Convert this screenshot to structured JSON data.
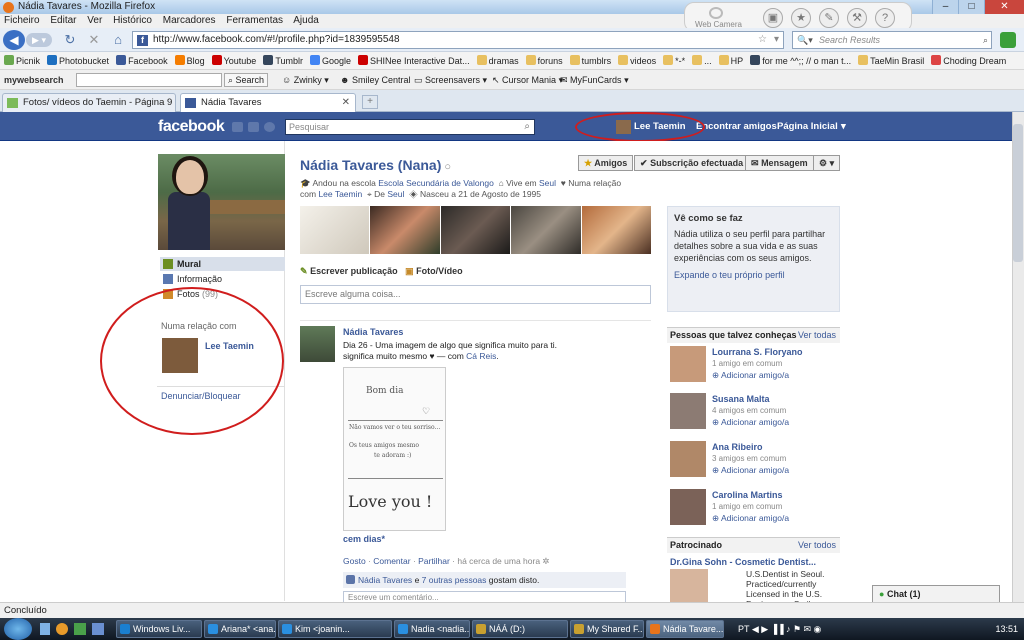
{
  "window": {
    "title": "Nádia Tavares - Mozilla Firefox"
  },
  "menu": [
    "Ficheiro",
    "Editar",
    "Ver",
    "Histórico",
    "Marcadores",
    "Ferramentas",
    "Ajuda"
  ],
  "webcam": {
    "label": "Web Camera"
  },
  "nav": {
    "url": "http://www.facebook.com/#!/profile.php?id=1839595548",
    "search_placeholder": "Search Results"
  },
  "bookmarks": [
    {
      "label": "Picnik",
      "color": "#6aa84f"
    },
    {
      "label": "Photobucket",
      "color": "#1d6fc0"
    },
    {
      "label": "Facebook",
      "color": "#3b5998"
    },
    {
      "label": "Blog",
      "color": "#f57d00"
    },
    {
      "label": "Youtube",
      "color": "#cc0000"
    },
    {
      "label": "Tumblr",
      "color": "#35465c"
    },
    {
      "label": "Google",
      "color": "#4285f4"
    },
    {
      "label": "SHINee Interactive Dat...",
      "color": "#cc0000"
    },
    {
      "label": "dramas",
      "color": "#e8c060"
    },
    {
      "label": "foruns",
      "color": "#e8c060"
    },
    {
      "label": "tumblrs",
      "color": "#e8c060"
    },
    {
      "label": "videos",
      "color": "#e8c060"
    },
    {
      "label": "*-*",
      "color": "#e8c060"
    },
    {
      "label": "...",
      "color": "#e8c060"
    },
    {
      "label": "HP",
      "color": "#e8c060"
    },
    {
      "label": "for me ^^;; // o man t...",
      "color": "#35465c"
    },
    {
      "label": "TaeMin Brasil",
      "color": "#e8c060"
    },
    {
      "label": "Choding Dream",
      "color": "#d44"
    }
  ],
  "toolbar2": {
    "brand": "mywebsearch",
    "search_btn": "Search",
    "items": [
      "Zwinky",
      "Smiley Central",
      "Screensavers",
      "Cursor Mania",
      "MyFunCards"
    ]
  },
  "tabs": [
    {
      "label": "Fotos/ vídeos do Taemin - Página 9"
    },
    {
      "label": "Nádia Tavares"
    }
  ],
  "fb": {
    "logo": "facebook",
    "search_placeholder": "Pesquisar",
    "user": "Lee Taemin",
    "nav": [
      "Encontrar amigos",
      "Página Inicial"
    ],
    "left": {
      "nav": [
        {
          "label": "Mural"
        },
        {
          "label": "Informação"
        },
        {
          "label": "Fotos",
          "count": "(99)"
        }
      ],
      "relationship_heading": "Numa relação com",
      "relationship_name": "Lee Taemin",
      "report": "Denunciar/Bloquear"
    },
    "profile": {
      "name": "Nádia Tavares (Nana)",
      "buttons": {
        "friends": "Amigos",
        "subscription": "Subscrição efectuada",
        "message": "Mensagem"
      },
      "info_school_prefix": "Andou na escola",
      "info_school": "Escola Secundária de Valongo",
      "info_lives_prefix": "Vive em",
      "info_lives": "Seul",
      "info_rel_prefix": "Numa relação com",
      "info_rel": "Lee Taemin",
      "info_from_prefix": "De",
      "info_from": "Seul",
      "info_born": "Nasceu a 21 de Agosto de 1995"
    },
    "composer": {
      "write": "Escrever publicação",
      "photo": "Foto/Vídeo",
      "placeholder": "Escreve alguma coisa..."
    },
    "post": {
      "author": "Nádia Tavares",
      "text": "Dia 26 - Uma imagem de algo que significa muito para ti. significa muito mesmo ♥",
      "with_prefix": "— com",
      "with": "Cá Reis",
      "image_lines": [
        "Bom dia",
        "Não vamos ver o teu sorriso...",
        "Os teus amigos mesmo",
        "te adoram :)",
        "Love you !"
      ],
      "caption": "cem dias*",
      "actions": {
        "like": "Gosto",
        "comment": "Comentar",
        "share": "Partilhar",
        "time": "há cerca de uma hora"
      },
      "likes_name": "Nádia Tavares",
      "likes_join": "e",
      "likes_others": "7 outras pessoas",
      "likes_suffix": "gostam disto.",
      "comment_placeholder": "Escreve um comentário..."
    },
    "how": {
      "title": "Vê como se faz",
      "text": "Nádia utiliza o seu perfil para partilhar detalhes sobre a sua vida e as suas experiências com os seus amigos.",
      "link": "Expande o teu próprio perfil"
    },
    "pymk": {
      "title": "Pessoas que talvez conheças",
      "see_all": "Ver todas",
      "people": [
        {
          "name": "Lourrana S. Floryano",
          "mutual": "1 amigo em comum",
          "add": "Adicionar amigo/a",
          "color": "#c79a7a"
        },
        {
          "name": "Susana Malta",
          "mutual": "4 amigos em comum",
          "add": "Adicionar amigo/a",
          "color": "#8c7b73"
        },
        {
          "name": "Ana Ribeiro",
          "mutual": "3 amigos em comum",
          "add": "Adicionar amigo/a",
          "color": "#b08868"
        },
        {
          "name": "Carolina Martins",
          "mutual": "1 amigo em comum",
          "add": "Adicionar amigo/a",
          "color": "#7b6258"
        }
      ]
    },
    "sponsored": {
      "title": "Patrocinado",
      "see_all": "Ver todos",
      "ad_title": "Dr.Gina Sohn - Cosmetic Dentist...",
      "ad_text": "U.S.Dentist in Seoul. Practiced/currently Licensed in the U.S. Design your Smile. Braces"
    },
    "chat": "Chat (1)"
  },
  "status": "Concluído",
  "taskbar": {
    "items": [
      "Windows Liv...",
      "Ariana* <ana...",
      "Kim <joanin...",
      "Nadia <nadia...",
      "NÁÁ (D:)",
      "My Shared F...",
      "Nádia Tavare..."
    ],
    "lang": "PT",
    "clock": "13:51"
  }
}
